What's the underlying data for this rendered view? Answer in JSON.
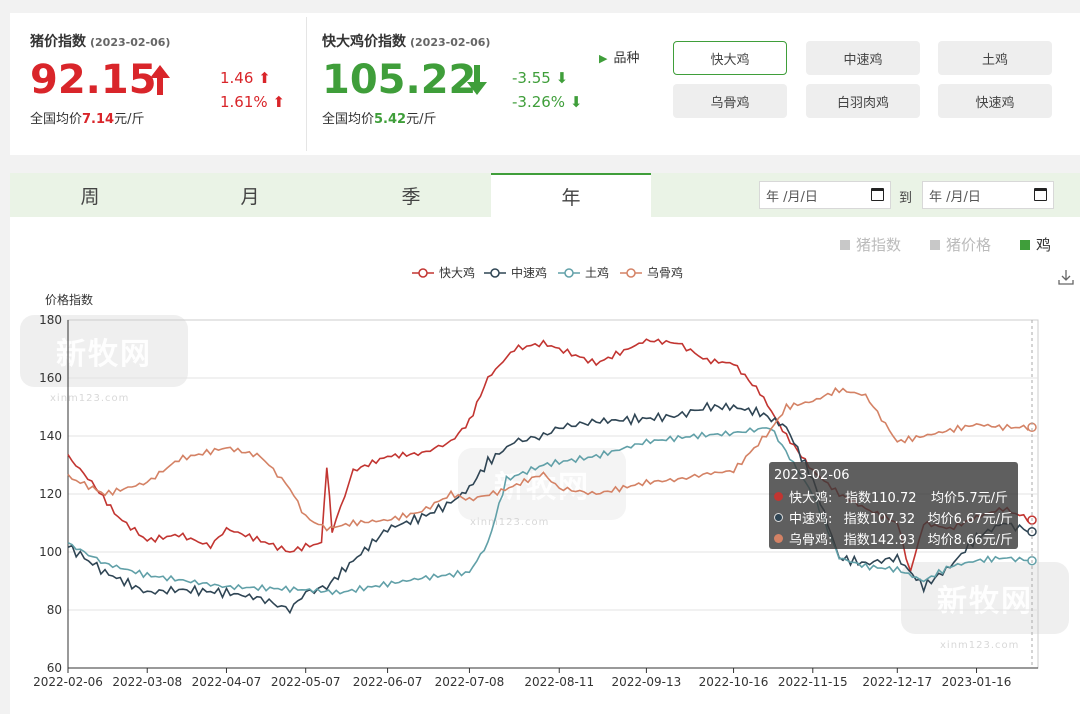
{
  "summary": {
    "pig": {
      "title": "猪价指数",
      "date": "(2023-02-06)",
      "value": "92.15",
      "change_abs": "1.46",
      "change_pct": "1.61%",
      "avg_label": "全国均价",
      "avg_value": "7.14",
      "avg_unit": "元/斤"
    },
    "chicken": {
      "title": "快大鸡价指数",
      "date": "(2023-02-06)",
      "value": "105.22",
      "change_abs": "-3.55",
      "change_pct": "-3.26%",
      "avg_label": "全国均价",
      "avg_value": "5.42",
      "avg_unit": "元/斤"
    }
  },
  "variety": {
    "label": "品种",
    "options": [
      "快大鸡",
      "中速鸡",
      "土鸡",
      "乌骨鸡",
      "白羽肉鸡",
      "快速鸡"
    ],
    "selected": "快大鸡"
  },
  "tabs": [
    "周",
    "月",
    "季",
    "年"
  ],
  "active_tab": "年",
  "date_range": {
    "start_placeholder": "年 /月/日",
    "to_label": "到",
    "end_placeholder": "年 /月/日"
  },
  "type_toggles": [
    "猪指数",
    "猪价格",
    "鸡"
  ],
  "active_type": "鸡",
  "colors": {
    "red": "#d9252a",
    "green": "#3f9e3a",
    "fast": "#c23531",
    "medium": "#2f4554",
    "local": "#61a0a8",
    "blackbone": "#d48265"
  },
  "watermark": {
    "text": "新牧网",
    "url": "xinm123.com"
  },
  "tooltip": {
    "date": "2023-02-06",
    "rows": [
      {
        "name": "快大鸡:",
        "index": "指数110.72",
        "price": "均价5.7元/斤",
        "color": "#c23531"
      },
      {
        "name": "中速鸡:",
        "index": "指数107.32",
        "price": "均价6.67元/斤",
        "color": "#2f4554"
      },
      {
        "name": "乌骨鸡:",
        "index": "指数142.93",
        "price": "均价8.66元/斤",
        "color": "#d48265"
      }
    ]
  },
  "chart_data": {
    "type": "line",
    "ylabel": "价格指数",
    "ylim": [
      60,
      180
    ],
    "yticks": [
      60,
      80,
      100,
      120,
      140,
      160,
      180
    ],
    "x_tick_labels": [
      "2022-02-06",
      "2022-03-08",
      "2022-04-07",
      "2022-05-07",
      "2022-06-07",
      "2022-07-08",
      "2022-08-11",
      "2022-09-13",
      "2022-10-16",
      "2022-11-15",
      "2022-12-17",
      "2023-01-16"
    ],
    "legend_position": "top",
    "grid": true,
    "series": [
      {
        "name": "快大鸡",
        "color": "#c23531",
        "points": [
          [
            "2022-02-06",
            133
          ],
          [
            "2022-02-15",
            124
          ],
          [
            "2022-02-25",
            112
          ],
          [
            "2022-03-08",
            104
          ],
          [
            "2022-03-20",
            106
          ],
          [
            "2022-04-01",
            102
          ],
          [
            "2022-04-07",
            108
          ],
          [
            "2022-04-20",
            104
          ],
          [
            "2022-05-01",
            100
          ],
          [
            "2022-05-07",
            102
          ],
          [
            "2022-05-13",
            103
          ],
          [
            "2022-05-15",
            130
          ],
          [
            "2022-05-17",
            107
          ],
          [
            "2022-05-25",
            128
          ],
          [
            "2022-06-07",
            133
          ],
          [
            "2022-06-20",
            134
          ],
          [
            "2022-07-01",
            138
          ],
          [
            "2022-07-08",
            145
          ],
          [
            "2022-07-15",
            160
          ],
          [
            "2022-07-25",
            170
          ],
          [
            "2022-08-05",
            172
          ],
          [
            "2022-08-11",
            170
          ],
          [
            "2022-08-25",
            165
          ],
          [
            "2022-09-06",
            170
          ],
          [
            "2022-09-13",
            173
          ],
          [
            "2022-09-25",
            172
          ],
          [
            "2022-10-06",
            166
          ],
          [
            "2022-10-16",
            165
          ],
          [
            "2022-10-26",
            155
          ],
          [
            "2022-11-05",
            140
          ],
          [
            "2022-11-15",
            128
          ],
          [
            "2022-11-25",
            120
          ],
          [
            "2022-12-05",
            115
          ],
          [
            "2022-12-17",
            110
          ],
          [
            "2022-12-22",
            93
          ],
          [
            "2022-12-27",
            110
          ],
          [
            "2023-01-06",
            108
          ],
          [
            "2023-01-16",
            112
          ],
          [
            "2023-01-26",
            115
          ],
          [
            "2023-02-06",
            111
          ]
        ]
      },
      {
        "name": "中速鸡",
        "color": "#2f4554",
        "points": [
          [
            "2022-02-06",
            102
          ],
          [
            "2022-02-20",
            93
          ],
          [
            "2022-03-08",
            86
          ],
          [
            "2022-03-20",
            87
          ],
          [
            "2022-04-07",
            86
          ],
          [
            "2022-04-20",
            84
          ],
          [
            "2022-05-01",
            80
          ],
          [
            "2022-05-07",
            86
          ],
          [
            "2022-05-15",
            88
          ],
          [
            "2022-05-25",
            97
          ],
          [
            "2022-06-07",
            108
          ],
          [
            "2022-06-20",
            112
          ],
          [
            "2022-07-01",
            117
          ],
          [
            "2022-07-08",
            122
          ],
          [
            "2022-07-15",
            131
          ],
          [
            "2022-07-25",
            138
          ],
          [
            "2022-08-05",
            140
          ],
          [
            "2022-08-11",
            143
          ],
          [
            "2022-08-25",
            145
          ],
          [
            "2022-09-13",
            146
          ],
          [
            "2022-09-25",
            147
          ],
          [
            "2022-10-06",
            150
          ],
          [
            "2022-10-16",
            150
          ],
          [
            "2022-10-26",
            148
          ],
          [
            "2022-11-05",
            143
          ],
          [
            "2022-11-15",
            125
          ],
          [
            "2022-11-25",
            98
          ],
          [
            "2022-12-05",
            96
          ],
          [
            "2022-12-17",
            98
          ],
          [
            "2022-12-27",
            88
          ],
          [
            "2023-01-06",
            95
          ],
          [
            "2023-01-16",
            105
          ],
          [
            "2023-01-26",
            110
          ],
          [
            "2023-02-06",
            107
          ]
        ]
      },
      {
        "name": "土鸡",
        "color": "#61a0a8",
        "points": [
          [
            "2022-02-06",
            103
          ],
          [
            "2022-02-20",
            96
          ],
          [
            "2022-03-08",
            92
          ],
          [
            "2022-04-07",
            88
          ],
          [
            "2022-05-07",
            87
          ],
          [
            "2022-05-20",
            86
          ],
          [
            "2022-06-07",
            89
          ],
          [
            "2022-06-20",
            91
          ],
          [
            "2022-07-08",
            93
          ],
          [
            "2022-07-15",
            103
          ],
          [
            "2022-07-22",
            125
          ],
          [
            "2022-08-05",
            130
          ],
          [
            "2022-08-11",
            131
          ],
          [
            "2022-08-25",
            133
          ],
          [
            "2022-09-13",
            138
          ],
          [
            "2022-10-01",
            140
          ],
          [
            "2022-10-16",
            141
          ],
          [
            "2022-10-30",
            143
          ],
          [
            "2022-11-15",
            120
          ],
          [
            "2022-11-25",
            98
          ],
          [
            "2022-12-05",
            95
          ],
          [
            "2022-12-17",
            94
          ],
          [
            "2022-12-27",
            90
          ],
          [
            "2023-01-06",
            95
          ],
          [
            "2023-01-16",
            97
          ],
          [
            "2023-01-26",
            98
          ],
          [
            "2023-02-06",
            97
          ]
        ]
      },
      {
        "name": "乌骨鸡",
        "color": "#d48265",
        "points": [
          [
            "2022-02-06",
            126
          ],
          [
            "2022-02-20",
            120
          ],
          [
            "2022-03-08",
            124
          ],
          [
            "2022-03-20",
            132
          ],
          [
            "2022-04-07",
            136
          ],
          [
            "2022-04-20",
            133
          ],
          [
            "2022-05-01",
            122
          ],
          [
            "2022-05-07",
            112
          ],
          [
            "2022-05-15",
            108
          ],
          [
            "2022-05-25",
            110
          ],
          [
            "2022-06-07",
            111
          ],
          [
            "2022-06-20",
            114
          ],
          [
            "2022-07-01",
            120
          ],
          [
            "2022-07-08",
            118
          ],
          [
            "2022-07-20",
            121
          ],
          [
            "2022-08-05",
            127
          ],
          [
            "2022-08-11",
            122
          ],
          [
            "2022-08-25",
            120
          ],
          [
            "2022-09-13",
            124
          ],
          [
            "2022-09-25",
            125
          ],
          [
            "2022-10-06",
            127
          ],
          [
            "2022-10-16",
            128
          ],
          [
            "2022-10-30",
            142
          ],
          [
            "2022-11-05",
            150
          ],
          [
            "2022-11-15",
            152
          ],
          [
            "2022-11-25",
            156
          ],
          [
            "2022-12-05",
            154
          ],
          [
            "2022-12-17",
            138
          ],
          [
            "2022-12-27",
            140
          ],
          [
            "2023-01-06",
            142
          ],
          [
            "2023-01-16",
            144
          ],
          [
            "2023-01-26",
            143
          ],
          [
            "2023-02-06",
            143
          ]
        ]
      }
    ]
  }
}
